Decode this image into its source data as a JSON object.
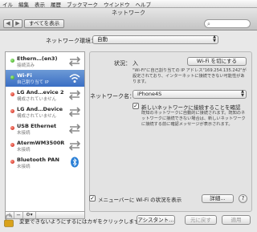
{
  "menubar": {
    "items": [
      "イル",
      "編集",
      "表示",
      "履歴",
      "ブックマーク",
      "ウインドウ",
      "ヘルプ"
    ]
  },
  "window": {
    "title": "ネットワーク",
    "show_all_label": "すべてを表示"
  },
  "location": {
    "label": "ネットワーク環境：",
    "value": "自動"
  },
  "services": [
    {
      "name": "Ethern…(en3)",
      "status": "接続済み",
      "status_color": "green",
      "icon": "ethernet-arrows-icon",
      "selected": false
    },
    {
      "name": "Wi-Fi",
      "status": "自己割り当て IP",
      "status_color": "green",
      "icon": "wifi-icon",
      "selected": true
    },
    {
      "name": "LG And…evice 2",
      "status": "構成されていません",
      "status_color": "red",
      "icon": "ethernet-arrows-icon",
      "selected": false
    },
    {
      "name": "LG And…Device",
      "status": "構成されていません",
      "status_color": "red",
      "icon": "ethernet-arrows-icon",
      "selected": false
    },
    {
      "name": "USB Ethernet",
      "status": "未接続",
      "status_color": "red",
      "icon": "ethernet-arrows-icon",
      "selected": false
    },
    {
      "name": "AtermWM3500R",
      "status": "未接続",
      "status_color": "red",
      "icon": "ethernet-arrows-icon",
      "selected": false
    },
    {
      "name": "Bluetooth PAN",
      "status": "未接続",
      "status_color": "red",
      "icon": "bluetooth-icon",
      "selected": false
    }
  ],
  "list_controls": {
    "add": "+",
    "remove": "−",
    "gear": "⚙▾"
  },
  "detail": {
    "status_label": "状況：",
    "status_value": "入",
    "wifi_off_button": "Wi-Fi を切にする",
    "status_desc": "\"Wi-Fi\"に自己割り当ての IP アドレス\"169.254.135.242\"が設定されており、インターネットに接続できない可能性があります。",
    "network_name_label": "ネットワーク名：",
    "network_name_value": "iPhone4S",
    "ask_join_label": "新しいネットワークに接続することを確認",
    "ask_join_checked": true,
    "ask_join_desc": "既知のネットワークに自動的に接続されます。既知のネットワークに接続できない場合は、新しいネットワークに接続する前に確認メッセージが表示されます。",
    "menubar_checkbox_label": "メニューバーに Wi-Fi の状況を表示",
    "menubar_checked": true,
    "advanced_button": "詳細…",
    "help_button": "?"
  },
  "footer": {
    "lock_text": "変更できないようにするにはカギをクリックします。",
    "assistant_button": "アシスタント…",
    "revert_button": "元に戻す",
    "apply_button": "適用"
  },
  "colors": {
    "selection": "#3a6fc4",
    "status_green": "#2b9a0f",
    "status_red": "#c4160a",
    "bluetooth": "#2a7fd6"
  }
}
